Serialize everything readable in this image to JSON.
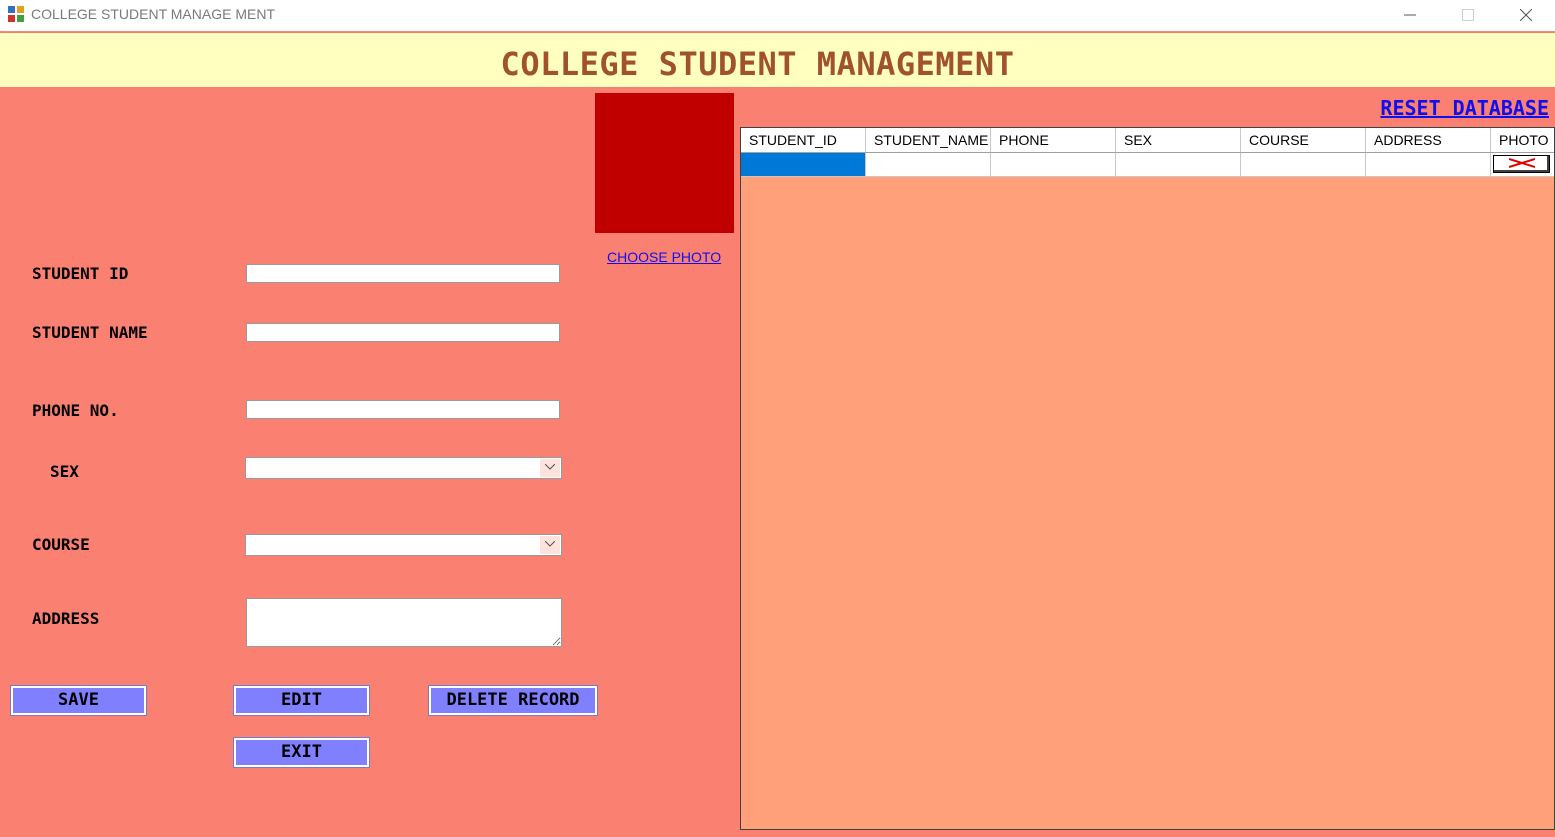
{
  "window": {
    "title": "COLLEGE STUDENT MANAGE MENT",
    "controls": [
      "minimize-icon",
      "maximize-icon",
      "close-icon"
    ]
  },
  "header": {
    "title": "COLLEGE STUDENT MANAGEMENT"
  },
  "form": {
    "student_id_label": "STUDENT ID",
    "student_name_label": "STUDENT NAME",
    "phone_label": "PHONE NO.",
    "sex_label": "SEX",
    "course_label": "COURSE",
    "address_label": "ADDRESS",
    "student_id_value": "",
    "student_name_value": "",
    "phone_value": "",
    "sex_value": "",
    "course_value": "",
    "address_value": ""
  },
  "photo": {
    "choose_label": "CHOOSE PHOTO",
    "frame_color": "#c00000"
  },
  "buttons": {
    "save": "SAVE",
    "edit": "EDIT",
    "delete": "DELETE RECORD",
    "exit": "EXIT"
  },
  "reset_link": "RESET DATABASE",
  "grid": {
    "columns": [
      "STUDENT_ID",
      "STUDENT_NAME",
      "PHONE",
      "SEX",
      "COURSE",
      "ADDRESS",
      "PHOTO"
    ],
    "rows": [
      [
        "",
        "",
        "",
        "",
        "",
        "",
        ""
      ]
    ],
    "selected_cell": "STUDENT_ID",
    "photo_cell_icon": "broken-image-icon"
  },
  "colors": {
    "background": "#fa8072",
    "banner": "#ffffc0",
    "title": "#a0522d",
    "button": "#8080ff",
    "grid_background": "#ffa07a",
    "selection": "#0078d7",
    "link": "#1010ee"
  }
}
